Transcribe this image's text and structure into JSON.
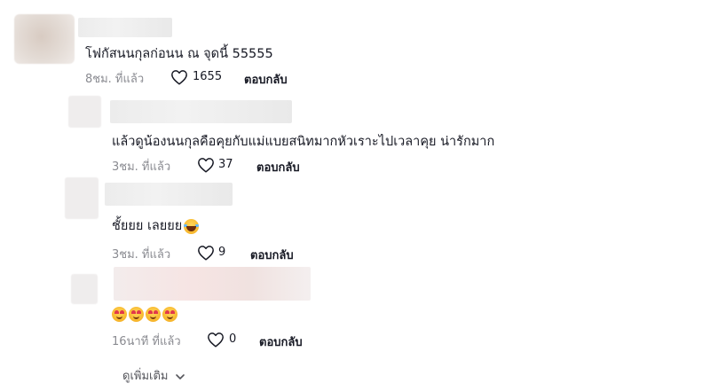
{
  "comments": [
    {
      "text": "โฟกัสนนกุลก่อนน ณ จุดนี้ 55555",
      "time": "8ชม. ที่แล้ว",
      "likes": "1655",
      "reply_label": "ตอบกลับ"
    }
  ],
  "replies": [
    {
      "text": "แล้วดูน้องนนกุลคือคุยกับแม่แบยสนิทมากหัวเราะไปเวลาคุย น่ารักมาก",
      "time": "3ชม. ที่แล้ว",
      "likes": "37",
      "reply_label": "ตอบกลับ"
    },
    {
      "text": "ชั้ยยย เลยยย",
      "emoji": "face-with-tears-of-joy",
      "time": "3ชม. ที่แล้ว",
      "likes": "9",
      "reply_label": "ตอบกลับ"
    },
    {
      "emoji": "smiling-face-with-heart-eyes",
      "emoji_count": 4,
      "time": "16นาที ที่แล้ว",
      "likes": "0",
      "reply_label": "ตอบกลับ"
    }
  ],
  "see_more_label": "ดูเพิ่มเติม",
  "icons": {
    "like": "heart-outline-icon",
    "expand": "chevron-down-icon"
  },
  "colors": {
    "text": "#161823",
    "meta": "#8a8b91"
  }
}
